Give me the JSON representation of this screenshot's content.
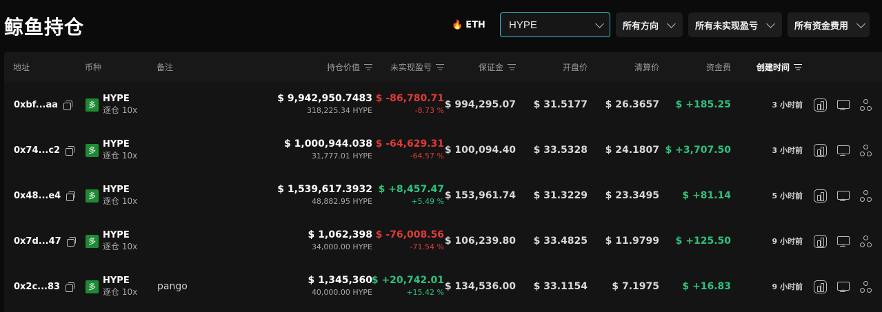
{
  "page": {
    "title": "鲸鱼持仓"
  },
  "filters": {
    "eth_icon": "fire-icon",
    "eth_label": "ETH",
    "search_value": "HYPE",
    "direction": "所有方向",
    "unrealized": "所有未实现盈亏",
    "funding": "所有资金费用"
  },
  "columns": {
    "address": "地址",
    "coin": "币种",
    "note": "备注",
    "position_value": "持仓价值",
    "unrealized_pnl": "未实现盈亏",
    "margin": "保证金",
    "open_price": "开盘价",
    "liq_price": "清算价",
    "funding": "资金费",
    "created": "创建时间"
  },
  "side_badge": "多",
  "rows": [
    {
      "address": "0xbf...aa",
      "coin": "HYPE",
      "leverage": "逐仓 10x",
      "note": "",
      "value": "$ 9,942,950.7483",
      "size": "318,225.34 HYPE",
      "pnl": "$ -86,780.71",
      "pnl_pct": "-8.73 %",
      "pnl_sign": "neg",
      "margin": "$ 994,295.07",
      "open": "$ 31.5177",
      "liq": "$ 26.3657",
      "funding": "$ +185.25",
      "funding_sign": "pos",
      "time": "3 小时前"
    },
    {
      "address": "0x74...c2",
      "coin": "HYPE",
      "leverage": "逐仓 10x",
      "note": "",
      "value": "$ 1,000,944.038",
      "size": "31,777.01 HYPE",
      "pnl": "$ -64,629.31",
      "pnl_pct": "-64.57 %",
      "pnl_sign": "neg",
      "margin": "$ 100,094.40",
      "open": "$ 33.5328",
      "liq": "$ 24.1807",
      "funding": "$ +3,707.50",
      "funding_sign": "pos",
      "time": "3 小时前"
    },
    {
      "address": "0x48...e4",
      "coin": "HYPE",
      "leverage": "逐仓 10x",
      "note": "",
      "value": "$ 1,539,617.3932",
      "size": "48,882.95 HYPE",
      "pnl": "$ +8,457.47",
      "pnl_pct": "+5.49 %",
      "pnl_sign": "pos",
      "margin": "$ 153,961.74",
      "open": "$ 31.3229",
      "liq": "$ 23.3495",
      "funding": "$ +81.14",
      "funding_sign": "pos",
      "time": "5 小时前"
    },
    {
      "address": "0x7d...47",
      "coin": "HYPE",
      "leverage": "逐仓 10x",
      "note": "",
      "value": "$ 1,062,398",
      "size": "34,000.00 HYPE",
      "pnl": "$ -76,008.56",
      "pnl_pct": "-71.54 %",
      "pnl_sign": "neg",
      "margin": "$ 106,239.80",
      "open": "$ 33.4825",
      "liq": "$ 11.9799",
      "funding": "$ +125.50",
      "funding_sign": "pos",
      "time": "9 小时前"
    },
    {
      "address": "0x2c...83",
      "coin": "HYPE",
      "leverage": "逐仓 10x",
      "note": "pango",
      "value": "$ 1,345,360",
      "size": "40,000.00 HYPE",
      "pnl": "$ +20,742.01",
      "pnl_pct": "+15.42 %",
      "pnl_sign": "pos",
      "margin": "$ 134,536.00",
      "open": "$ 33.1154",
      "liq": "$ 7.1975",
      "funding": "$ +16.83",
      "funding_sign": "pos",
      "time": "9 小时前"
    }
  ],
  "row_action_icons": [
    "chart-icon",
    "monitor-icon",
    "share-icon"
  ],
  "colors": {
    "positive": "#2ec27e",
    "negative": "#e03a3a",
    "accent": "#3fb6d4",
    "badge": "#1f8a34"
  }
}
